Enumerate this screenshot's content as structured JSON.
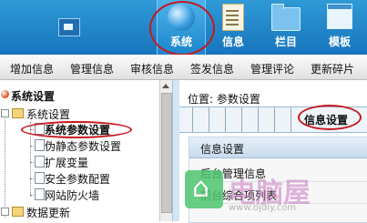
{
  "nav": {
    "tabs": [
      {
        "label": "系统",
        "icon": "globe-icon",
        "active": true
      },
      {
        "label": "信息",
        "icon": "notepad-icon",
        "active": false
      },
      {
        "label": "栏目",
        "icon": "folder-icon",
        "active": false
      },
      {
        "label": "模板",
        "icon": "window-icon",
        "active": false
      }
    ]
  },
  "menu": [
    "增加信息",
    "管理信息",
    "审核信息",
    "签发信息",
    "管理评论",
    "更新碎片"
  ],
  "sidebar": {
    "title": "系统设置",
    "tree": {
      "group": "系统设置",
      "items": [
        "系统参数设置",
        "伪静态参数设置",
        "扩展变量",
        "安全参数配置",
        "网站防火墙"
      ],
      "next_group": "数据更新"
    }
  },
  "main": {
    "location_label": "位置:",
    "location_value": "参数设置",
    "tab": "信息设置",
    "panel": {
      "header": "信息设置",
      "rows": [
        "后台管理信息",
        "前台综合项列表"
      ]
    }
  },
  "watermark": {
    "text": "电脑屋",
    "url": "www.bjdiy.com"
  },
  "colors": {
    "accent": "#1775bd",
    "highlight_ring": "#c8181f"
  }
}
